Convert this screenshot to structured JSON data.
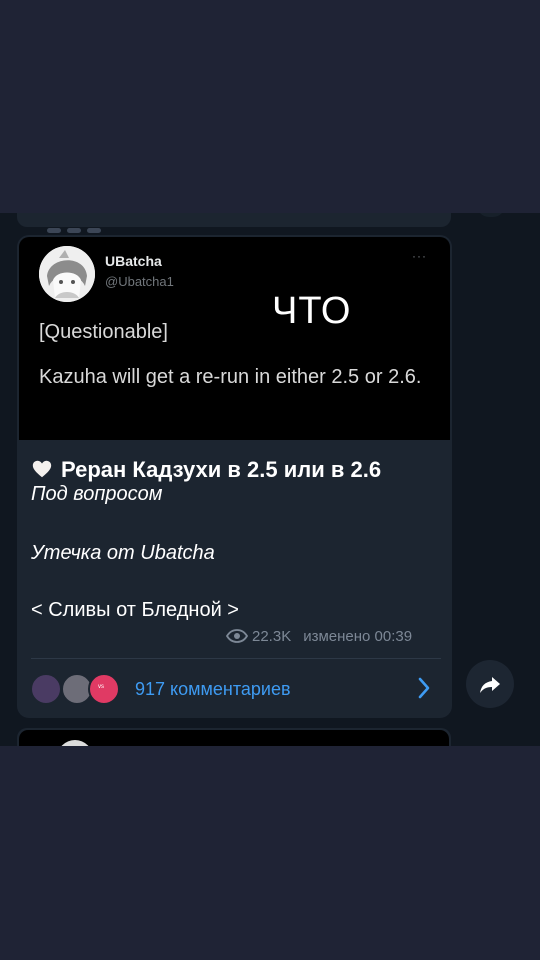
{
  "tweet": {
    "author_name": "UBatcha",
    "author_handle": "@Ubatcha1",
    "more": "···",
    "line1": "[Questionable]",
    "line2": "Kazuha will get a re-run in either 2.5 or 2.6."
  },
  "overlay_text": "ЧТО",
  "post": {
    "title": "Реран Кадзухи в 2.5 или в 2.6",
    "line_status": "Под вопросом",
    "line_source": "Утечка от Ubatcha",
    "line_channel": "< Сливы от Бледной >",
    "views": "22.3K",
    "edited_time": "изменено 00:39"
  },
  "comments": {
    "label": "917 комментариев",
    "badge": "vs"
  },
  "colors": {
    "background": "#1f2335",
    "chat_background": "#101720",
    "bubble": "#1c2530",
    "link": "#3e9bf2",
    "meta": "#7d8896"
  },
  "icons": [
    "heart-icon",
    "eye-icon",
    "chevron-right-icon",
    "share-icon"
  ]
}
